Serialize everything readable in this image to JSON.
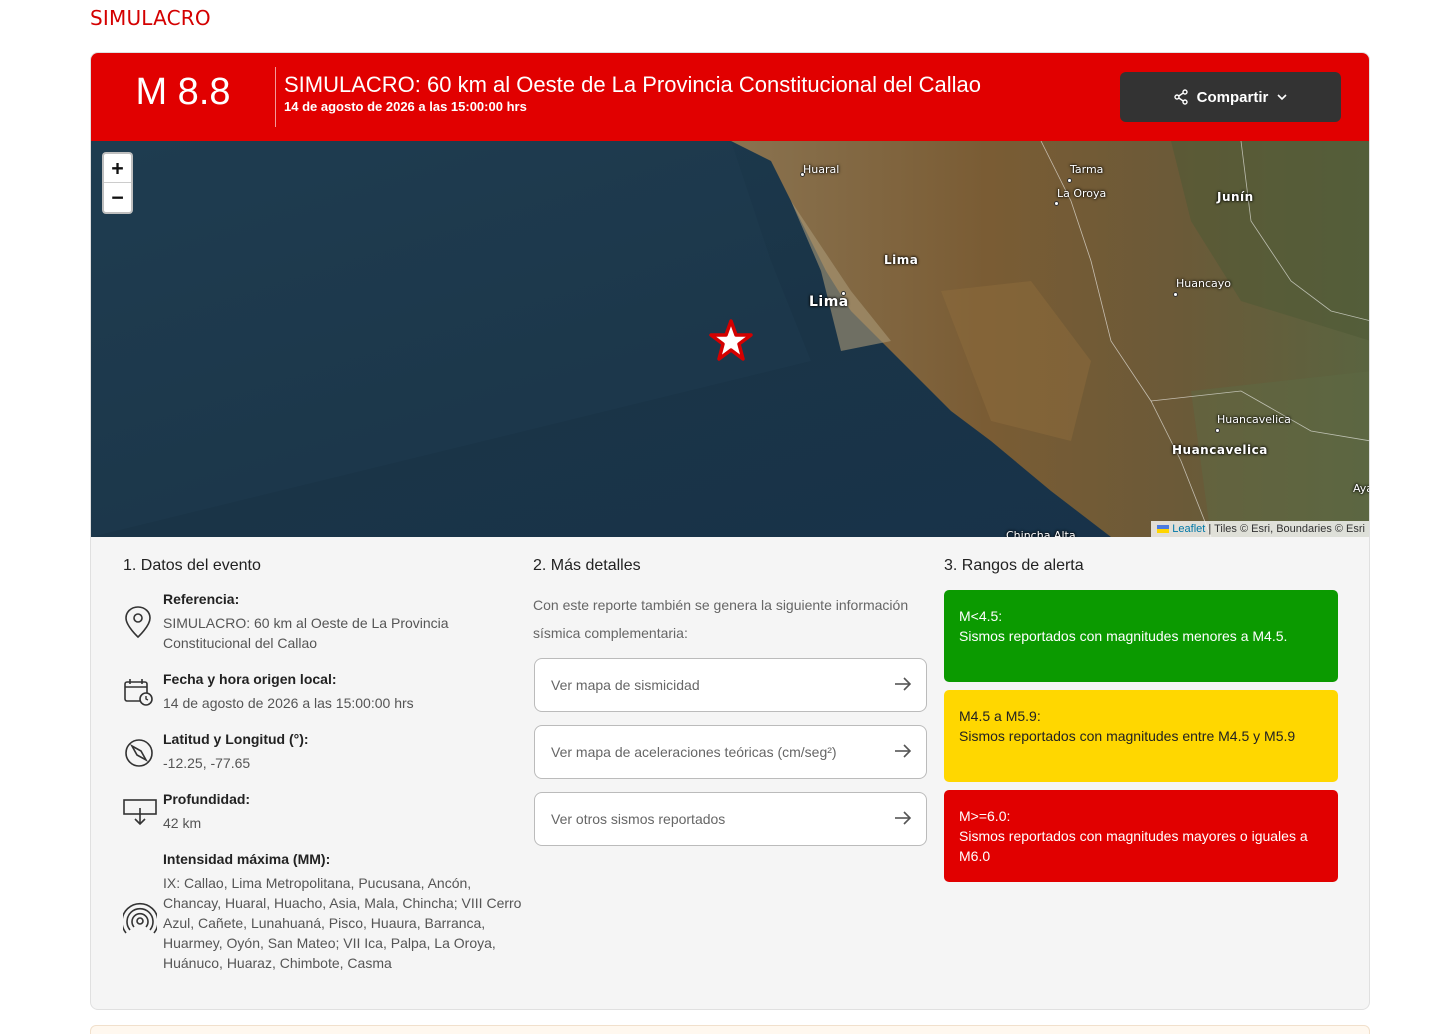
{
  "top_tag": "SIMULACRO",
  "banner": {
    "magnitude": "M 8.8",
    "title": "SIMULACRO: 60 km al Oeste de La Provincia Constitucional del Callao",
    "date": "14 de agosto de 2026 a las 15:00:00 hrs",
    "share_label": "Compartir"
  },
  "map": {
    "zoom_in": "+",
    "zoom_out": "−",
    "places": {
      "huaral": "Huaral",
      "tarma": "Tarma",
      "la_oroya": "La Oroya",
      "junin": "Junín",
      "lima_region": "Lima",
      "lima_city": "Lima",
      "huancayo": "Huancayo",
      "huancavelica_city": "Huancavelica",
      "huancavelica_region": "Huancavelica",
      "chincha_alta": "Chincha Alta",
      "ayacucho": "Aya"
    },
    "attribution": {
      "leaflet": "Leaflet",
      "rest": " | Tiles © Esri, Boundaries © Esri"
    }
  },
  "section1": {
    "title": "1. Datos del evento",
    "referencia_label": "Referencia:",
    "referencia_value": "SIMULACRO: 60 km al Oeste de La Provincia Constitucional del Callao",
    "fecha_label": "Fecha y hora origen local:",
    "fecha_value": "14 de agosto de 2026 a las 15:00:00 hrs",
    "latlon_label": "Latitud y Longitud (°):",
    "latlon_value": "-12.25, -77.65",
    "profundidad_label": "Profundidad:",
    "profundidad_value": "42 km",
    "intensidad_label": "Intensidad máxima (MM):",
    "intensidad_value": "IX: Callao, Lima Metropolitana, Pucusana, Ancón, Chancay, Huaral, Huacho, Asia, Mala, Chincha; VIII Cerro Azul, Cañete, Lunahuaná, Pisco, Huaura, Barranca, Huarmey, Oyón, San Mateo; VII Ica, Palpa, La Oroya, Huánuco, Huaraz, Chimbote, Casma"
  },
  "section2": {
    "title": "2. Más detalles",
    "intro": "Con este reporte también se genera la siguiente información sísmica complementaria:",
    "links": [
      "Ver mapa de sismicidad",
      "Ver mapa de aceleraciones teóricas (cm/seg²)",
      "Ver otros sismos reportados"
    ]
  },
  "section3": {
    "title": "3. Rangos de alerta",
    "ranges": [
      {
        "range": "M<4.5:",
        "text": "Sismos reportados con magnitudes menores a M4.5."
      },
      {
        "range": "M4.5 a M5.9:",
        "text": "Sismos reportados con magnitudes entre M4.5 y M5.9"
      },
      {
        "range": "M>=6.0:",
        "text": "Sismos reportados con magnitudes mayores o iguales a M6.0"
      }
    ]
  },
  "colors": {
    "brand_red": "#e10000",
    "alert_green": "#0b9a00",
    "alert_yellow": "#ffd700",
    "share_button": "#333333"
  }
}
